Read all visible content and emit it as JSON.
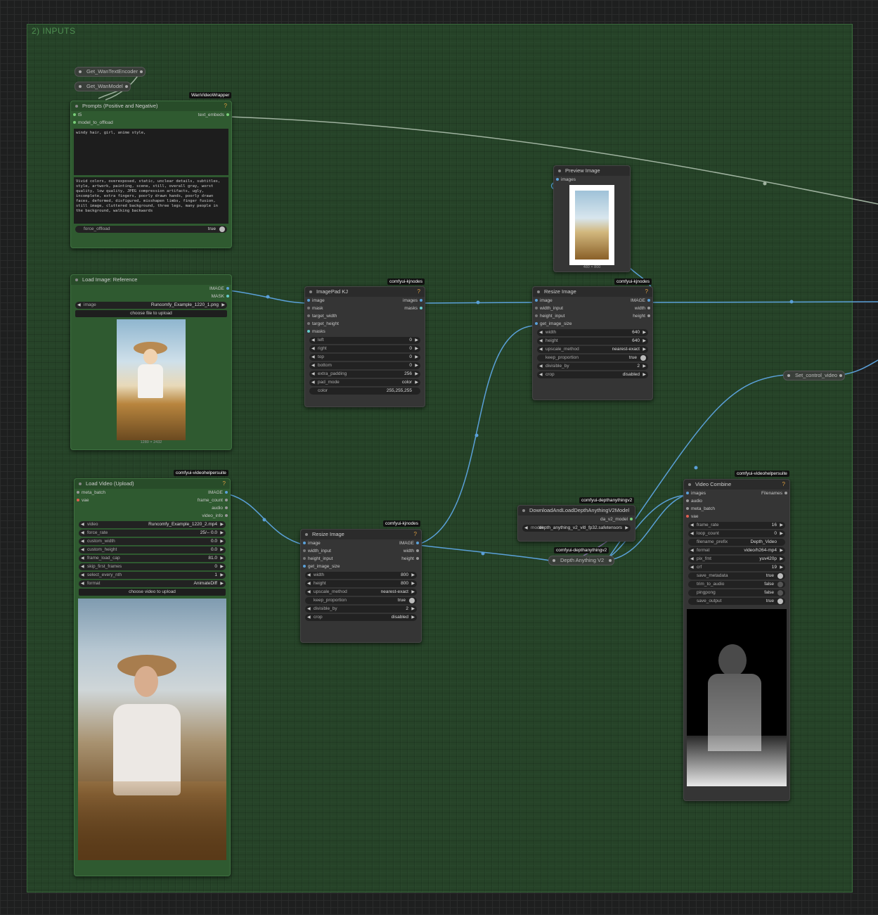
{
  "group": {
    "title": "2) INPUTS"
  },
  "reroutes": {
    "text_encoder": "Get_WanTextEncoder",
    "model": "Get_WanModel",
    "control_video": "Set_control_video"
  },
  "prompts": {
    "badge": "WanVideoWrapper",
    "title": "Prompts (Positive and Negative)",
    "help": "?",
    "in_t5": "t5",
    "in_model": "model_to_offload",
    "out": "text_embeds",
    "positive": "windy hair, girl, anime style,",
    "negative": "Vivid colors, overexposed, static, unclear details, subtitles, style, artwork, painting, scene, still, overall gray, worst quality, low quality, JPEG compression artifacts, ugly, incomplete, extra fingers, poorly drawn hands, poorly drawn faces, deformed, disfigured, misshapen limbs, finger fusion, still image, cluttered background, three legs, many people in the background, walking backwards",
    "force_offload_label": "force_offload",
    "force_offload_value": "true"
  },
  "load_image": {
    "title": "Load Image: Reference",
    "out_image": "IMAGE",
    "out_mask": "MASK",
    "image_label": "image",
    "image_value": "Runcomfy_Example_1220_1.png",
    "upload": "choose file to upload",
    "size": "1280 × 2432"
  },
  "imagepad": {
    "badge": "comfyui-kjnodes",
    "title": "ImagePad KJ",
    "help": "?",
    "inputs": [
      "image",
      "mask",
      "target_width",
      "target_height",
      "masks"
    ],
    "out_images": "images",
    "out_masks": "masks",
    "widgets": [
      {
        "k": "left",
        "v": "0"
      },
      {
        "k": "right",
        "v": "0"
      },
      {
        "k": "top",
        "v": "0"
      },
      {
        "k": "bottom",
        "v": "0"
      },
      {
        "k": "extra_padding",
        "v": "256"
      },
      {
        "k": "pad_mode",
        "v": "color"
      }
    ],
    "color_label": "color",
    "color_value": "255,255,255"
  },
  "preview": {
    "title": "Preview Image",
    "in_images": "images",
    "size": "480 × 800"
  },
  "resize1": {
    "badge": "comfyui-kjnodes",
    "title": "Resize Image",
    "help": "?",
    "inputs": [
      "image",
      "width_input",
      "height_input",
      "get_image_size"
    ],
    "outputs": [
      "IMAGE",
      "width",
      "height"
    ],
    "widgets": [
      {
        "k": "width",
        "v": "640"
      },
      {
        "k": "height",
        "v": "640"
      },
      {
        "k": "upscale_method",
        "v": "nearest-exact"
      },
      {
        "k": "keep_proportion",
        "v": "true",
        "toggle": true
      },
      {
        "k": "divisible_by",
        "v": "2"
      },
      {
        "k": "crop",
        "v": "disabled"
      }
    ]
  },
  "load_video": {
    "badge": "comfyui-videohelpersuite",
    "title": "Load Video (Upload)",
    "help": "?",
    "inputs": [
      "meta_batch",
      "vae"
    ],
    "outputs": [
      "IMAGE",
      "frame_count",
      "audio",
      "video_info"
    ],
    "widgets": [
      {
        "k": "video",
        "v": "Runcomfy_Example_1220_2.mp4"
      },
      {
        "k": "force_rate",
        "v": "25/-- 0.0"
      },
      {
        "k": "custom_width",
        "v": "0.0"
      },
      {
        "k": "custom_height",
        "v": "0.0"
      },
      {
        "k": "frame_load_cap",
        "v": "81.0"
      },
      {
        "k": "skip_first_frames",
        "v": "0"
      },
      {
        "k": "select_every_nth",
        "v": "1"
      },
      {
        "k": "format",
        "v": "AnimateDiff"
      }
    ],
    "upload": "choose video to upload"
  },
  "resize2": {
    "badge": "comfyui-kjnodes",
    "title": "Resize Image",
    "help": "?",
    "inputs": [
      "image",
      "width_input",
      "height_input",
      "get_image_size"
    ],
    "outputs": [
      "IMAGE",
      "width",
      "height"
    ],
    "widgets": [
      {
        "k": "width",
        "v": "800"
      },
      {
        "k": "height",
        "v": "800"
      },
      {
        "k": "upscale_method",
        "v": "nearest-exact"
      },
      {
        "k": "keep_proportion",
        "v": "true",
        "toggle": true
      },
      {
        "k": "divisible_by",
        "v": "2"
      },
      {
        "k": "crop",
        "v": "disabled"
      }
    ]
  },
  "download": {
    "badge": "comfyui-depthanythingv2",
    "title": "DownloadAndLoadDepthAnythingV2Model",
    "out": "da_v2_model",
    "model_label": "model",
    "model_value": "depth_anything_v2_vitl_fp32.safetensors"
  },
  "depth": {
    "badge": "comfyui-depthanythingv2",
    "title": "Depth Anything V2"
  },
  "video_combine": {
    "badge": "comfyui-videohelpersuite",
    "title": "Video Combine",
    "help": "?",
    "inputs": [
      "images",
      "audio",
      "meta_batch",
      "vae"
    ],
    "out": "Filenames",
    "widgets": [
      {
        "k": "frame_rate",
        "v": "16"
      },
      {
        "k": "loop_count",
        "v": "0"
      },
      {
        "k": "filename_prefix",
        "v": "Depth_Video",
        "plain": true
      },
      {
        "k": "format",
        "v": "video/h264-mp4"
      },
      {
        "k": "pix_fmt",
        "v": "yuv420p"
      },
      {
        "k": "crf",
        "v": "19"
      },
      {
        "k": "save_metadata",
        "v": "true",
        "toggle": true
      },
      {
        "k": "trim_to_audio",
        "v": "false",
        "toggle": true
      },
      {
        "k": "pingpong",
        "v": "false",
        "toggle": true
      },
      {
        "k": "save_output",
        "v": "true",
        "toggle": true
      }
    ]
  }
}
